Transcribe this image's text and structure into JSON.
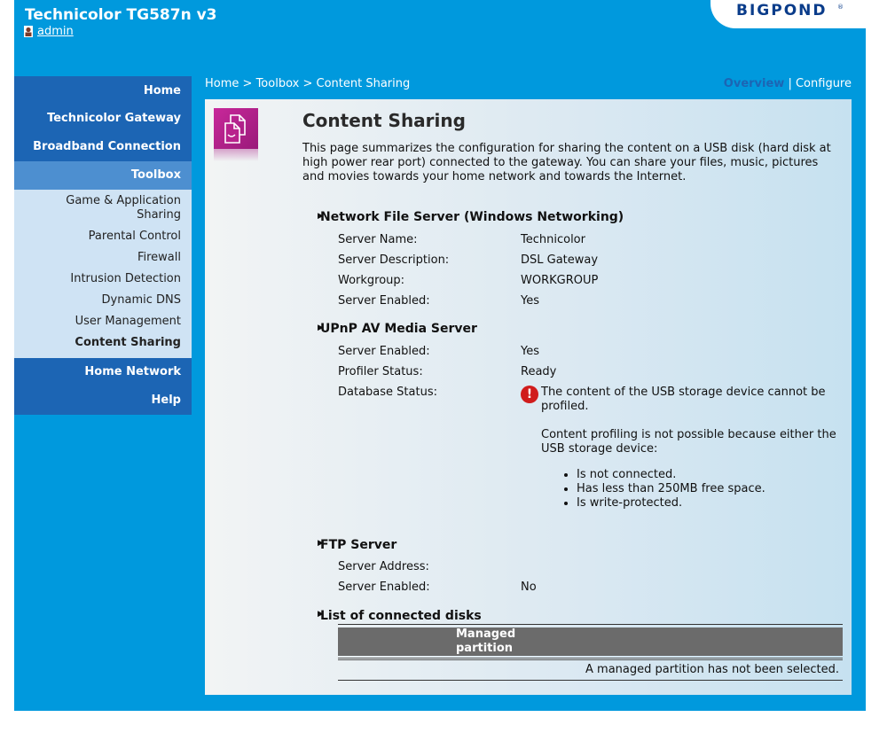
{
  "header": {
    "product_title": "Technicolor TG587n v3",
    "user": "admin",
    "logo_text": "BIGPOND",
    "logo_mark": "®"
  },
  "sidebar": {
    "items": [
      {
        "label": "Home"
      },
      {
        "label": "Technicolor Gateway"
      },
      {
        "label": "Broadband Connection"
      },
      {
        "label": "Toolbox"
      }
    ],
    "sub_items": [
      {
        "label_line1": "Game & Application",
        "label_line2": "Sharing"
      },
      {
        "label": "Parental Control"
      },
      {
        "label": "Firewall"
      },
      {
        "label": "Intrusion Detection"
      },
      {
        "label": "Dynamic DNS"
      },
      {
        "label": "User Management"
      },
      {
        "label": "Content Sharing"
      }
    ],
    "bottom_items": [
      {
        "label": "Home Network"
      },
      {
        "label": "Help"
      }
    ]
  },
  "breadcrumb": {
    "home": "Home",
    "sep1": ">",
    "toolbox": "Toolbox",
    "sep2": ">",
    "current": "Content Sharing"
  },
  "view_links": {
    "overview": "Overview",
    "sep": "|",
    "configure": "Configure"
  },
  "page": {
    "title": "Content Sharing",
    "intro": "This page summarizes the configuration for sharing the content on a USB disk (hard disk at high power rear port) connected to the gateway. You can share your files, music, pictures and movies towards your home network and towards the Internet."
  },
  "sections": {
    "nfs": {
      "title": "Network File Server (Windows Networking)",
      "server_name_label": "Server Name:",
      "server_name": "Technicolor",
      "server_desc_label": "Server Description:",
      "server_desc": "DSL Gateway",
      "workgroup_label": "Workgroup:",
      "workgroup": "WORKGROUP",
      "enabled_label": "Server Enabled:",
      "enabled": "Yes"
    },
    "upnp": {
      "title": "UPnP AV Media Server",
      "enabled_label": "Server Enabled:",
      "enabled": "Yes",
      "profiler_label": "Profiler Status:",
      "profiler": "Ready",
      "database_label": "Database Status:",
      "error_title": "The content of the USB storage device cannot be profiled.",
      "error_detail": "Content profiling is not possible because either the USB storage device:",
      "error_reasons": [
        "Is not connected.",
        "Has less than 250MB free space.",
        "Is write-protected."
      ]
    },
    "ftp": {
      "title": "FTP Server",
      "address_label": "Server Address:",
      "address": "",
      "enabled_label": "Server Enabled:",
      "enabled": "No"
    },
    "disks": {
      "title": "List of connected disks",
      "column_line1": "Managed",
      "column_line2": "partition",
      "empty_message": "A managed partition has not been selected."
    }
  },
  "icons": {
    "user": "user-icon",
    "page": "content-sharing-icon",
    "arrow": "right-triangle-icon",
    "error": "error-icon"
  },
  "colors": {
    "frame_blue": "#0099dd",
    "nav_blue": "#1c65b4",
    "nav_active": "#4d8fd0",
    "subnav_bg": "#cfe3f4",
    "page_icon": "#c8289a",
    "error_red": "#d01c1c"
  }
}
